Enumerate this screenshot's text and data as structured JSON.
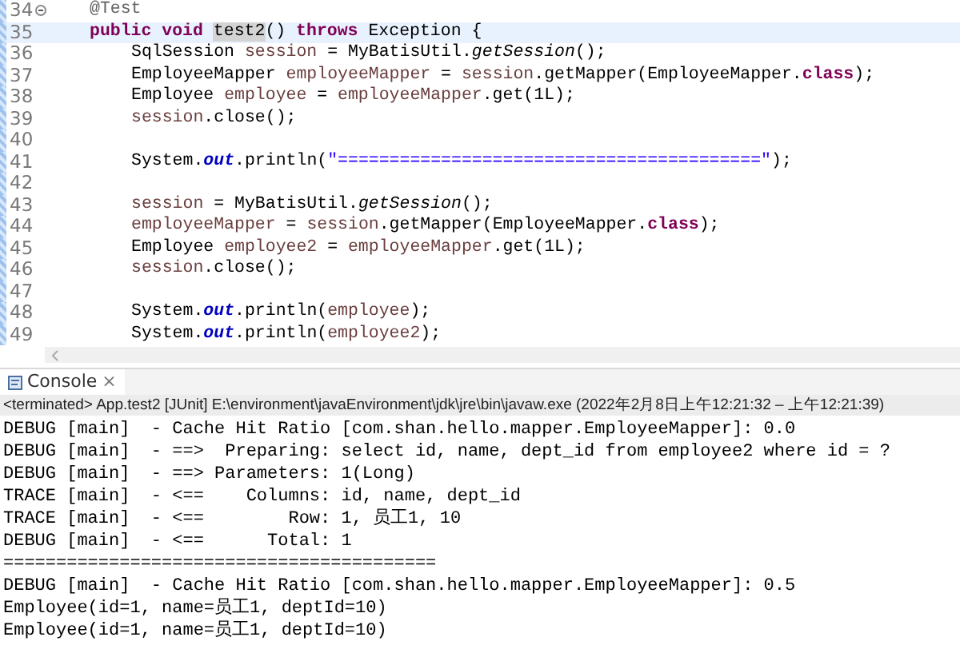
{
  "editor": {
    "lines": [
      {
        "number": "34",
        "kind": "member",
        "fold": true,
        "current": false,
        "tokens": [
          {
            "kind": "annotation",
            "text": "@Test"
          }
        ]
      },
      {
        "number": "35",
        "kind": "member",
        "fold": false,
        "current": true,
        "tokens": [
          {
            "kind": "keyword",
            "text": "public void "
          },
          {
            "kind": "occurrence",
            "text": "test2"
          },
          {
            "kind": "plain",
            "text": "() "
          },
          {
            "kind": "keyword",
            "text": "throws"
          },
          {
            "kind": "plain",
            "text": " Exception {"
          }
        ]
      },
      {
        "number": "36",
        "kind": "statement",
        "fold": false,
        "current": false,
        "tokens": [
          {
            "kind": "plain",
            "text": "SqlSession "
          },
          {
            "kind": "variable",
            "text": "session"
          },
          {
            "kind": "plain",
            "text": " = MyBatisUtil."
          },
          {
            "kind": "static",
            "text": "getSession"
          },
          {
            "kind": "plain",
            "text": "();"
          }
        ]
      },
      {
        "number": "37",
        "kind": "statement",
        "fold": false,
        "current": false,
        "tokens": [
          {
            "kind": "plain",
            "text": "EmployeeMapper "
          },
          {
            "kind": "variable",
            "text": "employeeMapper"
          },
          {
            "kind": "plain",
            "text": " = "
          },
          {
            "kind": "variable",
            "text": "session"
          },
          {
            "kind": "plain",
            "text": ".getMapper(EmployeeMapper."
          },
          {
            "kind": "keyword",
            "text": "class"
          },
          {
            "kind": "plain",
            "text": ");"
          }
        ]
      },
      {
        "number": "38",
        "kind": "statement",
        "fold": false,
        "current": false,
        "tokens": [
          {
            "kind": "plain",
            "text": "Employee "
          },
          {
            "kind": "variable",
            "text": "employee"
          },
          {
            "kind": "plain",
            "text": " = "
          },
          {
            "kind": "variable",
            "text": "employeeMapper"
          },
          {
            "kind": "plain",
            "text": ".get(1L);"
          }
        ]
      },
      {
        "number": "39",
        "kind": "statement",
        "fold": false,
        "current": false,
        "tokens": [
          {
            "kind": "variable",
            "text": "session"
          },
          {
            "kind": "plain",
            "text": ".close();"
          }
        ]
      },
      {
        "number": "40",
        "fold": false,
        "current": false
      },
      {
        "number": "41",
        "kind": "statement",
        "fold": false,
        "current": false,
        "tokens": [
          {
            "kind": "plain",
            "text": "System."
          },
          {
            "kind": "static-field",
            "text": "out"
          },
          {
            "kind": "plain",
            "text": ".println("
          },
          {
            "kind": "string",
            "text": "\"=========================================\""
          },
          {
            "kind": "plain",
            "text": ");"
          }
        ]
      },
      {
        "number": "42",
        "fold": false,
        "current": false
      },
      {
        "number": "43",
        "kind": "statement",
        "fold": false,
        "current": false,
        "tokens": [
          {
            "kind": "variable",
            "text": "session"
          },
          {
            "kind": "plain",
            "text": " = MyBatisUtil."
          },
          {
            "kind": "static",
            "text": "getSession"
          },
          {
            "kind": "plain",
            "text": "();"
          }
        ]
      },
      {
        "number": "44",
        "kind": "statement",
        "fold": false,
        "current": false,
        "tokens": [
          {
            "kind": "variable",
            "text": "employeeMapper"
          },
          {
            "kind": "plain",
            "text": " = "
          },
          {
            "kind": "variable",
            "text": "session"
          },
          {
            "kind": "plain",
            "text": ".getMapper(EmployeeMapper."
          },
          {
            "kind": "keyword",
            "text": "class"
          },
          {
            "kind": "plain",
            "text": ");"
          }
        ]
      },
      {
        "number": "45",
        "kind": "statement",
        "fold": false,
        "current": false,
        "tokens": [
          {
            "kind": "plain",
            "text": "Employee "
          },
          {
            "kind": "variable",
            "text": "employee2"
          },
          {
            "kind": "plain",
            "text": " = "
          },
          {
            "kind": "variable",
            "text": "employeeMapper"
          },
          {
            "kind": "plain",
            "text": ".get(1L);"
          }
        ]
      },
      {
        "number": "46",
        "kind": "statement",
        "fold": false,
        "current": false,
        "tokens": [
          {
            "kind": "variable",
            "text": "session"
          },
          {
            "kind": "plain",
            "text": ".close();"
          }
        ]
      },
      {
        "number": "47",
        "fold": false,
        "current": false
      },
      {
        "number": "48",
        "kind": "statement",
        "fold": false,
        "current": false,
        "tokens": [
          {
            "kind": "plain",
            "text": "System."
          },
          {
            "kind": "static-field",
            "text": "out"
          },
          {
            "kind": "plain",
            "text": ".println("
          },
          {
            "kind": "variable",
            "text": "employee"
          },
          {
            "kind": "plain",
            "text": ");"
          }
        ]
      },
      {
        "number": "49",
        "kind": "statement",
        "fold": false,
        "current": false,
        "tokens": [
          {
            "kind": "plain",
            "text": "System."
          },
          {
            "kind": "static-field",
            "text": "out"
          },
          {
            "kind": "plain",
            "text": ".println("
          },
          {
            "kind": "variable",
            "text": "employee2"
          },
          {
            "kind": "plain",
            "text": ");"
          }
        ]
      }
    ]
  },
  "console": {
    "tab": {
      "label": "Console",
      "close": "×"
    },
    "status": "<terminated> App.test2 [JUnit] E:\\environment\\javaEnvironment\\jdk\\jre\\bin\\javaw.exe  (2022年2月8日上午12:21:32 – 上午12:21:39)",
    "output": [
      "DEBUG [main]  - Cache Hit Ratio [com.shan.hello.mapper.EmployeeMapper]: 0.0",
      "DEBUG [main]  - ==>  Preparing: select id, name, dept_id from employee2 where id = ?",
      "DEBUG [main]  - ==> Parameters: 1(Long)",
      "TRACE [main]  - <==    Columns: id, name, dept_id",
      "TRACE [main]  - <==        Row: 1, 员工1, 10",
      "DEBUG [main]  - <==      Total: 1",
      "=========================================",
      "DEBUG [main]  - Cache Hit Ratio [com.shan.hello.mapper.EmployeeMapper]: 0.5",
      "Employee(id=1, name=员工1, deptId=10)",
      "Employee(id=1, name=员工1, deptId=10)"
    ]
  }
}
